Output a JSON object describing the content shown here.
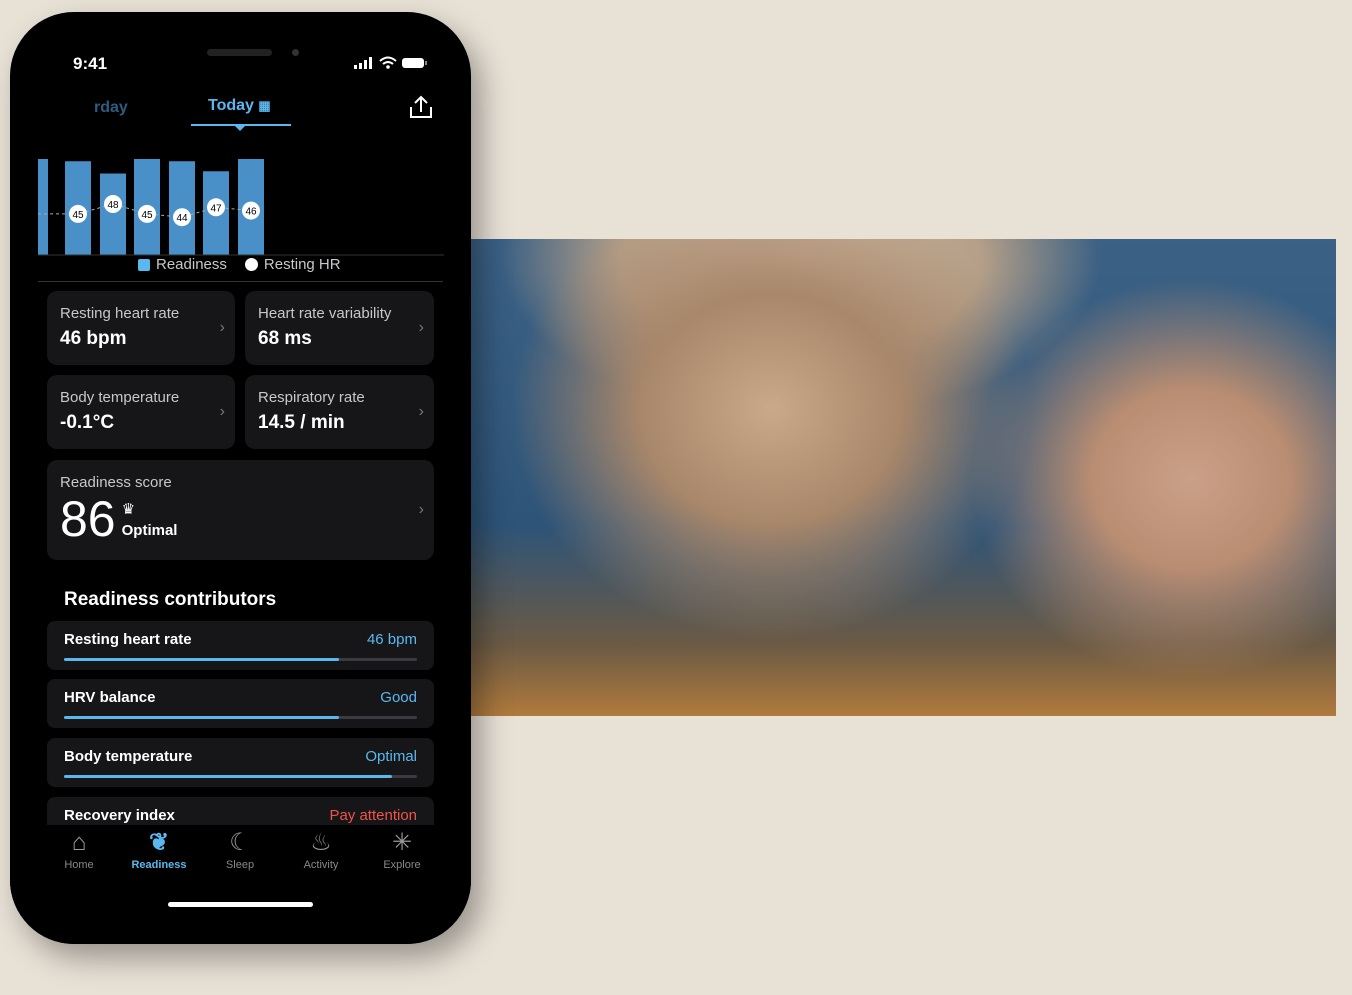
{
  "status": {
    "time": "9:41"
  },
  "tabs": {
    "prev": "rday",
    "current": "Today"
  },
  "chart_data": {
    "type": "bar",
    "series": [
      {
        "name": "Readiness",
        "values": [
          86,
          84,
          73,
          86,
          84,
          75,
          86
        ]
      },
      {
        "name": "Resting HR",
        "values": [
          null,
          45,
          48,
          45,
          44,
          47,
          46
        ]
      }
    ],
    "legend_position": "bottom",
    "colors": {
      "Readiness": "#4a90c8",
      "Resting HR": "#ffffff"
    }
  },
  "legend": {
    "readiness": "Readiness",
    "hr": "Resting HR"
  },
  "metrics": [
    {
      "label": "Resting heart rate",
      "value": "46 bpm"
    },
    {
      "label": "Heart rate variability",
      "value": "68 ms"
    },
    {
      "label": "Body temperature",
      "value": "-0.1°C"
    },
    {
      "label": "Respiratory rate",
      "value": "14.5 / min"
    }
  ],
  "score": {
    "label": "Readiness score",
    "value": "86",
    "status": "Optimal",
    "icon": "crown-icon"
  },
  "contributors": {
    "title": "Readiness contributors",
    "items": [
      {
        "name": "Resting heart rate",
        "value": "46 bpm",
        "progress": 0.78,
        "color": "#5ab8ee"
      },
      {
        "name": "HRV balance",
        "value": "Good",
        "progress": 0.78,
        "color": "#5ab8ee"
      },
      {
        "name": "Body temperature",
        "value": "Optimal",
        "progress": 0.93,
        "color": "#5ab8ee"
      },
      {
        "name": "Recovery index",
        "value": "Pay attention",
        "color": "#f0534a"
      }
    ]
  },
  "nav": [
    {
      "label": "Home",
      "icon": "home-icon"
    },
    {
      "label": "Readiness",
      "icon": "sprout-icon",
      "active": true
    },
    {
      "label": "Sleep",
      "icon": "moon-icon"
    },
    {
      "label": "Activity",
      "icon": "flame-icon"
    },
    {
      "label": "Explore",
      "icon": "sparkle-icon"
    }
  ],
  "accent": "#5ab8ee"
}
